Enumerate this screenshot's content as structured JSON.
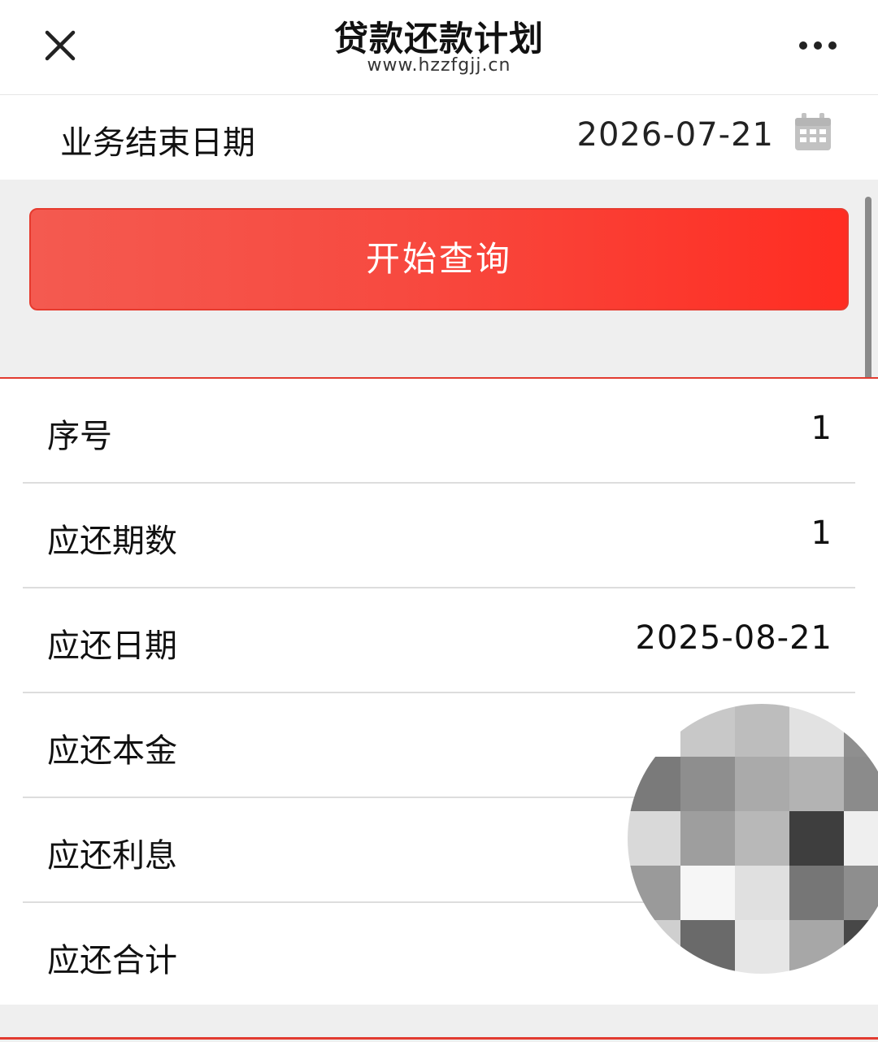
{
  "nav": {
    "title": "贷款还款计划",
    "url": "www.hzzfgjj.cn",
    "close_icon": "close-icon",
    "more_icon": "more-icon"
  },
  "query": {
    "date_label": "业务结束日期",
    "date_value": "2026-07-21",
    "calendar_icon": "calendar-icon",
    "button_label": "开始查询"
  },
  "schedule": {
    "rows": [
      {
        "label": "序号",
        "value": "1"
      },
      {
        "label": "应还期数",
        "value": "1"
      },
      {
        "label": "应还日期",
        "value": "2025-08-21"
      },
      {
        "label": "应还本金",
        "value": ""
      },
      {
        "label": "应还利息",
        "value": ""
      },
      {
        "label": "应还合计",
        "value": ""
      }
    ]
  },
  "colors": {
    "accent": "#e23b30",
    "button_start": "#f45a50",
    "button_end": "#ff2d22",
    "page_bg": "#efefef"
  },
  "redaction": {
    "pattern": [
      [
        "#ffffff",
        "#c8c8c8",
        "#bdbdbd",
        "#e2e2e2",
        "#8f8f8f"
      ],
      [
        "#7a7a7a",
        "#8e8e8e",
        "#aaaaaa",
        "#b3b3b3",
        "#8b8b8b"
      ],
      [
        "#d9d9d9",
        "#9e9e9e",
        "#b8b8b8",
        "#3e3e3e",
        "#efefef"
      ],
      [
        "#9a9a9a",
        "#f6f6f6",
        "#e0e0e0",
        "#767676",
        "#8e8e8e"
      ],
      [
        "#cfcfcf",
        "#6a6a6a",
        "#e6e6e6",
        "#a7a7a7",
        "#474747"
      ]
    ]
  }
}
